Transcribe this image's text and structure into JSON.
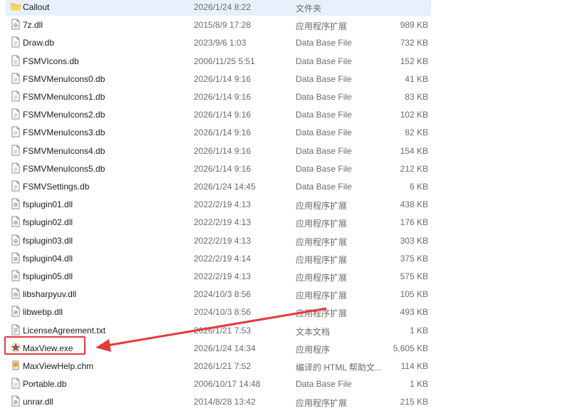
{
  "colors": {
    "accent_highlight": "#e43a3a",
    "selected_row": "#e6f1fb",
    "folder": "#f4c542"
  },
  "files": [
    {
      "name": "Callout",
      "date": "2026/1/24 8:22",
      "type": "文件夹",
      "size": "",
      "icon": "folder-icon"
    },
    {
      "name": "7z.dll",
      "date": "2015/8/9 17:28",
      "type": "应用程序扩展",
      "size": "989 KB",
      "icon": "dll-file-icon"
    },
    {
      "name": "Draw.db",
      "date": "2023/9/6 1:03",
      "type": "Data Base File",
      "size": "732 KB",
      "icon": "db-file-icon"
    },
    {
      "name": "FSMVIcons.db",
      "date": "2006/11/25 5:51",
      "type": "Data Base File",
      "size": "152 KB",
      "icon": "db-file-icon"
    },
    {
      "name": "FSMVMenuIcons0.db",
      "date": "2026/1/14 9:16",
      "type": "Data Base File",
      "size": "41 KB",
      "icon": "db-file-icon"
    },
    {
      "name": "FSMVMenuIcons1.db",
      "date": "2026/1/14 9:16",
      "type": "Data Base File",
      "size": "83 KB",
      "icon": "db-file-icon"
    },
    {
      "name": "FSMVMenuIcons2.db",
      "date": "2026/1/14 9:16",
      "type": "Data Base File",
      "size": "102 KB",
      "icon": "db-file-icon"
    },
    {
      "name": "FSMVMenuIcons3.db",
      "date": "2026/1/14 9:16",
      "type": "Data Base File",
      "size": "82 KB",
      "icon": "db-file-icon"
    },
    {
      "name": "FSMVMenuIcons4.db",
      "date": "2026/1/14 9:16",
      "type": "Data Base File",
      "size": "154 KB",
      "icon": "db-file-icon"
    },
    {
      "name": "FSMVMenuIcons5.db",
      "date": "2026/1/14 9:16",
      "type": "Data Base File",
      "size": "212 KB",
      "icon": "db-file-icon"
    },
    {
      "name": "FSMVSettings.db",
      "date": "2026/1/24 14:45",
      "type": "Data Base File",
      "size": "6 KB",
      "icon": "db-file-icon"
    },
    {
      "name": "fsplugin01.dll",
      "date": "2022/2/19 4:13",
      "type": "应用程序扩展",
      "size": "438 KB",
      "icon": "dll-file-icon"
    },
    {
      "name": "fsplugin02.dll",
      "date": "2022/2/19 4:13",
      "type": "应用程序扩展",
      "size": "176 KB",
      "icon": "dll-file-icon"
    },
    {
      "name": "fsplugin03.dll",
      "date": "2022/2/19 4:13",
      "type": "应用程序扩展",
      "size": "303 KB",
      "icon": "dll-file-icon"
    },
    {
      "name": "fsplugin04.dll",
      "date": "2022/2/19 4:14",
      "type": "应用程序扩展",
      "size": "375 KB",
      "icon": "dll-file-icon"
    },
    {
      "name": "fsplugin05.dll",
      "date": "2022/2/19 4:13",
      "type": "应用程序扩展",
      "size": "575 KB",
      "icon": "dll-file-icon"
    },
    {
      "name": "libsharpyuv.dll",
      "date": "2024/10/3 8:56",
      "type": "应用程序扩展",
      "size": "105 KB",
      "icon": "dll-file-icon"
    },
    {
      "name": "libwebp.dll",
      "date": "2024/10/3 8:56",
      "type": "应用程序扩展",
      "size": "493 KB",
      "icon": "dll-file-icon"
    },
    {
      "name": "LicenseAgreement.txt",
      "date": "2026/1/21 7:53",
      "type": "文本文档",
      "size": "1 KB",
      "icon": "txt-file-icon"
    },
    {
      "name": "MaxView.exe",
      "date": "2026/1/24 14:34",
      "type": "应用程序",
      "size": "5,605 KB",
      "icon": "maxview-app-icon"
    },
    {
      "name": "MaxViewHelp.chm",
      "date": "2026/1/21 7:52",
      "type": "编译的 HTML 帮助文...",
      "size": "114 KB",
      "icon": "chm-help-icon"
    },
    {
      "name": "Portable.db",
      "date": "2006/10/17 14:48",
      "type": "Data Base File",
      "size": "1 KB",
      "icon": "db-file-icon"
    },
    {
      "name": "unrar.dll",
      "date": "2014/8/28 13:42",
      "type": "应用程序扩展",
      "size": "215 KB",
      "icon": "dll-file-icon"
    }
  ]
}
